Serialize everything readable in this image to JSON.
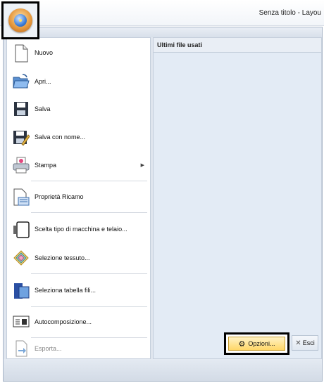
{
  "window": {
    "title": "Senza titolo - Layou"
  },
  "app_button": {
    "icon": "app-orb-icon"
  },
  "recent": {
    "header": "Ultimi file usati"
  },
  "menu": {
    "items": [
      {
        "label": "Nuovo",
        "icon": "new-document-icon",
        "enabled": true
      },
      {
        "label": "Apri...",
        "icon": "open-folder-icon",
        "enabled": true
      },
      {
        "label": "Salva",
        "icon": "save-icon",
        "enabled": true
      },
      {
        "label": "Salva con nome...",
        "icon": "save-as-icon",
        "enabled": true
      },
      {
        "label": "Stampa",
        "icon": "printer-icon",
        "enabled": true,
        "submenu": true
      },
      {
        "label": "Proprietà Ricamo",
        "icon": "embroidery-properties-icon",
        "enabled": true
      },
      {
        "label": "Scelta tipo di macchina e telaio...",
        "icon": "hoop-icon",
        "enabled": true
      },
      {
        "label": "Selezione tessuto...",
        "icon": "fabric-icon",
        "enabled": true
      },
      {
        "label": "Seleziona tabella fili...",
        "icon": "thread-chart-icon",
        "enabled": true
      },
      {
        "label": "Autocomposizione...",
        "icon": "wizard-icon",
        "enabled": true
      },
      {
        "label": "Esporta...",
        "icon": "export-icon",
        "enabled": false
      }
    ]
  },
  "footer": {
    "options_label": "Opzioni...",
    "exit_label": "Esci"
  }
}
